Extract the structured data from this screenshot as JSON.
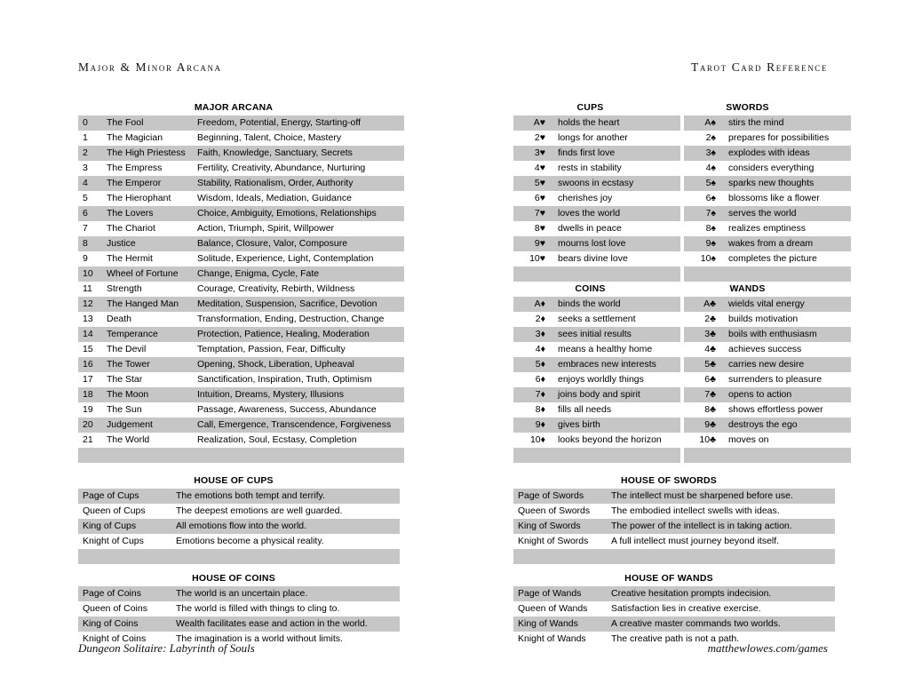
{
  "header": {
    "left": "Major & Minor Arcana",
    "right": "Tarot Card Reference"
  },
  "footer": {
    "left": "Dungeon Solitaire: Labyrinth of Souls",
    "right": "matthewlowes.com/games"
  },
  "colors": {
    "row_shaded": "#c6c6c6",
    "row_plain": "#ffffff",
    "text": "#000000"
  },
  "major_arcana": {
    "title": "MAJOR ARCANA",
    "rows": [
      {
        "num": "0",
        "name": "The Fool",
        "desc": "Freedom, Potential, Energy, Starting-off"
      },
      {
        "num": "1",
        "name": "The Magician",
        "desc": "Beginning, Talent, Choice, Mastery"
      },
      {
        "num": "2",
        "name": "The High Priestess",
        "desc": "Faith, Knowledge, Sanctuary, Secrets"
      },
      {
        "num": "3",
        "name": "The Empress",
        "desc": "Fertility, Creativity, Abundance, Nurturing"
      },
      {
        "num": "4",
        "name": "The Emperor",
        "desc": "Stability, Rationalism, Order, Authority"
      },
      {
        "num": "5",
        "name": "The Hierophant",
        "desc": "Wisdom, Ideals, Mediation, Guidance"
      },
      {
        "num": "6",
        "name": "The Lovers",
        "desc": "Choice, Ambiguity, Emotions, Relationships"
      },
      {
        "num": "7",
        "name": "The Chariot",
        "desc": "Action, Triumph, Spirit, Willpower"
      },
      {
        "num": "8",
        "name": "Justice",
        "desc": "Balance, Closure, Valor, Composure"
      },
      {
        "num": "9",
        "name": "The Hermit",
        "desc": "Solitude, Experience, Light, Contemplation"
      },
      {
        "num": "10",
        "name": "Wheel of Fortune",
        "desc": "Change, Enigma, Cycle, Fate"
      },
      {
        "num": "11",
        "name": "Strength",
        "desc": "Courage, Creativity, Rebirth, Wildness"
      },
      {
        "num": "12",
        "name": "The Hanged Man",
        "desc": "Meditation, Suspension, Sacrifice, Devotion"
      },
      {
        "num": "13",
        "name": "Death",
        "desc": "Transformation, Ending, Destruction, Change"
      },
      {
        "num": "14",
        "name": "Temperance",
        "desc": "Protection, Patience, Healing, Moderation"
      },
      {
        "num": "15",
        "name": "The Devil",
        "desc": "Temptation, Passion, Fear, Difficulty"
      },
      {
        "num": "16",
        "name": "The Tower",
        "desc": "Opening, Shock, Liberation, Upheaval"
      },
      {
        "num": "17",
        "name": "The Star",
        "desc": "Sanctification, Inspiration, Truth, Optimism"
      },
      {
        "num": "18",
        "name": "The Moon",
        "desc": "Intuition, Dreams, Mystery, Illusions"
      },
      {
        "num": "19",
        "name": "The Sun",
        "desc": "Passage, Awareness, Success, Abundance"
      },
      {
        "num": "20",
        "name": "Judgement",
        "desc": "Call, Emergence, Transcendence, Forgiveness"
      },
      {
        "num": "21",
        "name": "The World",
        "desc": "Realization, Soul, Ecstasy, Completion"
      }
    ]
  },
  "cups": {
    "title": "CUPS",
    "suit_symbol": "♥",
    "rows": [
      {
        "rank": "A",
        "phrase": "holds the heart"
      },
      {
        "rank": "2",
        "phrase": "longs for another"
      },
      {
        "rank": "3",
        "phrase": "finds first love"
      },
      {
        "rank": "4",
        "phrase": "rests in stability"
      },
      {
        "rank": "5",
        "phrase": "swoons in ecstasy"
      },
      {
        "rank": "6",
        "phrase": "cherishes joy"
      },
      {
        "rank": "7",
        "phrase": "loves the world"
      },
      {
        "rank": "8",
        "phrase": "dwells in peace"
      },
      {
        "rank": "9",
        "phrase": "mourns lost love"
      },
      {
        "rank": "10",
        "phrase": "bears divine love"
      }
    ]
  },
  "swords": {
    "title": "SWORDS",
    "suit_symbol": "♠",
    "rows": [
      {
        "rank": "A",
        "phrase": "stirs the mind"
      },
      {
        "rank": "2",
        "phrase": "prepares for possibilities"
      },
      {
        "rank": "3",
        "phrase": "explodes with ideas"
      },
      {
        "rank": "4",
        "phrase": "considers everything"
      },
      {
        "rank": "5",
        "phrase": "sparks new thoughts"
      },
      {
        "rank": "6",
        "phrase": "blossoms like a flower"
      },
      {
        "rank": "7",
        "phrase": "serves the world"
      },
      {
        "rank": "8",
        "phrase": "realizes emptiness"
      },
      {
        "rank": "9",
        "phrase": "wakes from a dream"
      },
      {
        "rank": "10",
        "phrase": "completes the picture"
      }
    ]
  },
  "coins": {
    "title": "COINS",
    "suit_symbol": "♦",
    "rows": [
      {
        "rank": "A",
        "phrase": "binds the world"
      },
      {
        "rank": "2",
        "phrase": "seeks a settlement"
      },
      {
        "rank": "3",
        "phrase": "sees initial results"
      },
      {
        "rank": "4",
        "phrase": "means a healthy home"
      },
      {
        "rank": "5",
        "phrase": "embraces new interests"
      },
      {
        "rank": "6",
        "phrase": "enjoys worldly things"
      },
      {
        "rank": "7",
        "phrase": "joins body and spirit"
      },
      {
        "rank": "8",
        "phrase": "fills all needs"
      },
      {
        "rank": "9",
        "phrase": "gives birth"
      },
      {
        "rank": "10",
        "phrase": "looks beyond the horizon"
      }
    ]
  },
  "wands": {
    "title": "WANDS",
    "suit_symbol": "♣",
    "rows": [
      {
        "rank": "A",
        "phrase": "wields vital energy"
      },
      {
        "rank": "2",
        "phrase": "builds motivation"
      },
      {
        "rank": "3",
        "phrase": "boils with enthusiasm"
      },
      {
        "rank": "4",
        "phrase": "achieves success"
      },
      {
        "rank": "5",
        "phrase": "carries new desire"
      },
      {
        "rank": "6",
        "phrase": "surrenders to pleasure"
      },
      {
        "rank": "7",
        "phrase": "opens to action"
      },
      {
        "rank": "8",
        "phrase": "shows effortless power"
      },
      {
        "rank": "9",
        "phrase": "destroys the ego"
      },
      {
        "rank": "10",
        "phrase": "moves on"
      }
    ]
  },
  "house_of_cups": {
    "title": "HOUSE OF CUPS",
    "rows": [
      {
        "court": "Page of Cups",
        "meaning": "The emotions both tempt and terrify."
      },
      {
        "court": "Queen of Cups",
        "meaning": "The deepest emotions are well guarded."
      },
      {
        "court": "King of Cups",
        "meaning": "All emotions flow into the world."
      },
      {
        "court": "Knight of Cups",
        "meaning": "Emotions become a physical reality."
      }
    ]
  },
  "house_of_swords": {
    "title": "HOUSE OF SWORDS",
    "rows": [
      {
        "court": "Page of Swords",
        "meaning": "The intellect must be sharpened before use."
      },
      {
        "court": "Queen of Swords",
        "meaning": "The embodied intellect swells with ideas."
      },
      {
        "court": "King of Swords",
        "meaning": "The power of the intellect is in taking action."
      },
      {
        "court": "Knight of Swords",
        "meaning": "A full intellect must journey beyond itself."
      }
    ]
  },
  "house_of_coins": {
    "title": "HOUSE OF COINS",
    "rows": [
      {
        "court": "Page of Coins",
        "meaning": "The world is an uncertain place."
      },
      {
        "court": "Queen of Coins",
        "meaning": "The world is filled with things to cling to."
      },
      {
        "court": "King of Coins",
        "meaning": "Wealth facilitates ease and action in the world."
      },
      {
        "court": "Knight of Coins",
        "meaning": "The imagination is a world without limits."
      }
    ]
  },
  "house_of_wands": {
    "title": "HOUSE OF WANDS",
    "rows": [
      {
        "court": "Page of Wands",
        "meaning": "Creative hesitation prompts indecision."
      },
      {
        "court": "Queen of Wands",
        "meaning": "Satisfaction lies in creative exercise."
      },
      {
        "court": "King of Wands",
        "meaning": "A creative master commands two worlds."
      },
      {
        "court": "Knight of Wands",
        "meaning": "The creative path is not a path."
      }
    ]
  }
}
